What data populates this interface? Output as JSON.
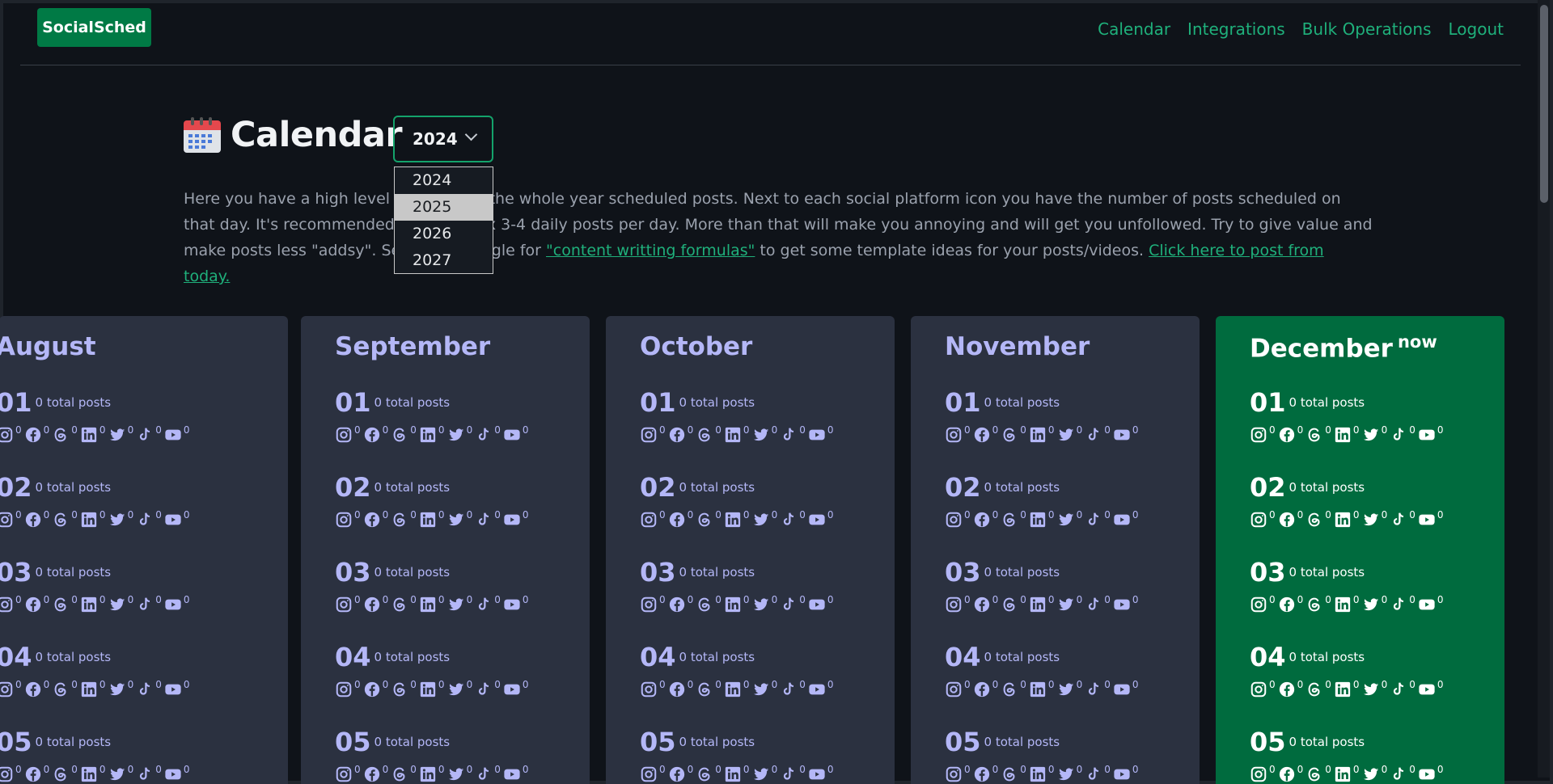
{
  "brand": "SocialSched",
  "nav": [
    "Calendar",
    "Integrations",
    "Bulk Operations",
    "Logout"
  ],
  "page_title": "Calendar",
  "year_select": {
    "value": "2024",
    "options": [
      "2024",
      "2025",
      "2026",
      "2027"
    ],
    "highlighted": "2025"
  },
  "intro": {
    "part1": "Here you have a high level overview of the whole year scheduled posts. Next to each social platform icon you have the number of posts scheduled on that day. It's recommended to have max 3-4 daily posts per day. More than that will make you annoying and will get you unfollowed. Try to give value and make posts less \"addsy\". Search on google for ",
    "link1": "\"content writting formulas\"",
    "part2": " to get some template ideas for your posts/videos. ",
    "link2": "Click here to post from today."
  },
  "now_label": "now",
  "day_total_label": "0 total posts",
  "platform_icons": [
    "instagram-icon",
    "facebook-icon",
    "threads-icon",
    "linkedin-icon",
    "twitter-icon",
    "tiktok-icon",
    "youtube-icon"
  ],
  "platform_count": "0",
  "months": [
    {
      "name": "August",
      "current": false
    },
    {
      "name": "September",
      "current": false
    },
    {
      "name": "October",
      "current": false
    },
    {
      "name": "November",
      "current": false
    },
    {
      "name": "December",
      "current": true
    }
  ],
  "days": [
    "01",
    "02",
    "03",
    "04",
    "05"
  ],
  "colors": {
    "background": "#0f1319",
    "accent": "#1fb07b",
    "brand": "#007a45",
    "card": "#2b3140",
    "current_card": "#006b3e",
    "card_text": "#b4b7f7"
  }
}
